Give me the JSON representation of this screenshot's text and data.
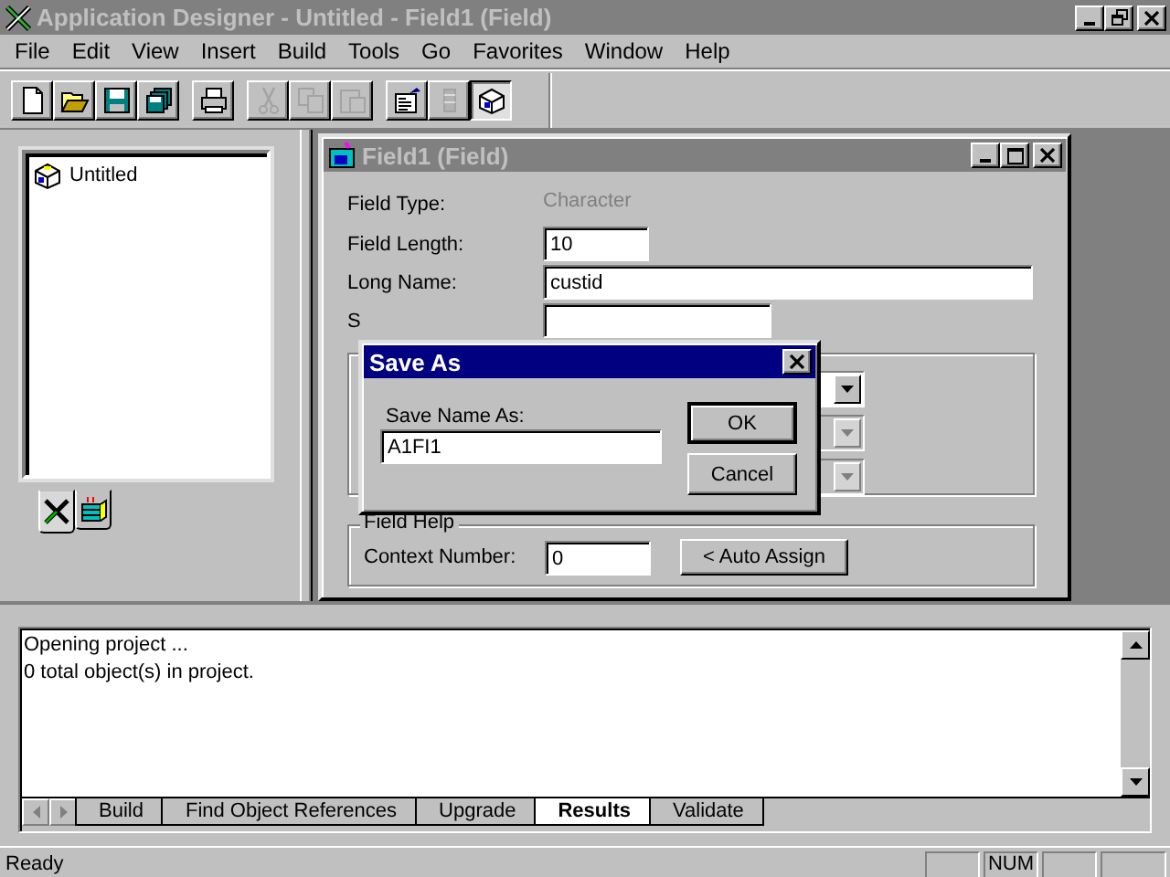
{
  "app": {
    "title": "Application Designer - Untitled - Field1 (Field)",
    "active": false
  },
  "menu": [
    {
      "label": "File"
    },
    {
      "label": "Edit"
    },
    {
      "label": "View"
    },
    {
      "label": "Insert"
    },
    {
      "label": "Build"
    },
    {
      "label": "Tools"
    },
    {
      "label": "Go"
    },
    {
      "label": "Favorites"
    },
    {
      "label": "Window"
    },
    {
      "label": "Help"
    }
  ],
  "toolbar": [
    {
      "kind": "new",
      "disabled": false,
      "pressed": false
    },
    {
      "kind": "open",
      "disabled": false,
      "pressed": false
    },
    {
      "kind": "save",
      "disabled": false,
      "pressed": false
    },
    {
      "kind": "save-all",
      "disabled": false,
      "pressed": false
    },
    {
      "kind": "sep"
    },
    {
      "kind": "print",
      "disabled": false,
      "pressed": false
    },
    {
      "kind": "sep"
    },
    {
      "kind": "cut",
      "disabled": true,
      "pressed": false
    },
    {
      "kind": "copy",
      "disabled": true,
      "pressed": false
    },
    {
      "kind": "paste",
      "disabled": true,
      "pressed": false
    },
    {
      "kind": "sep"
    },
    {
      "kind": "properties",
      "disabled": false,
      "pressed": false
    },
    {
      "kind": "script",
      "disabled": true,
      "pressed": false
    },
    {
      "kind": "workspace",
      "disabled": false,
      "pressed": true
    }
  ],
  "project": {
    "tree": [
      {
        "label": "Untitled",
        "selected": false
      }
    ],
    "tabs": [
      {
        "kind": "tools",
        "selected": true
      },
      {
        "kind": "objects",
        "selected": false
      }
    ]
  },
  "field_window": {
    "title": "Field1 (Field)",
    "active": false,
    "rows": [
      {
        "kind": "static",
        "label": "Field Type:",
        "value": "Character"
      },
      {
        "kind": "short",
        "label": "Field Length:",
        "value": "10"
      },
      {
        "kind": "long",
        "label": "Long Name:",
        "value": "custid"
      },
      {
        "kind": "medium",
        "label": "S"
      }
    ],
    "dropdowns": [
      {
        "disabled": false
      },
      {
        "disabled": true
      },
      {
        "disabled": true
      }
    ],
    "help": {
      "title": "Field Help",
      "label": "Context Number:",
      "value": "0",
      "button": "< Auto Assign"
    }
  },
  "dialog": {
    "title": "Save As",
    "label": "Save Name As:",
    "value": "A1FI1",
    "buttons": [
      {
        "label": "OK",
        "default": true
      },
      {
        "label": "Cancel",
        "default": false
      }
    ]
  },
  "output": {
    "lines": [
      "Opening project ...",
      "0  total object(s) in project."
    ],
    "tabs": [
      {
        "label": "Build",
        "selected": false
      },
      {
        "label": "Find Object References",
        "selected": false
      },
      {
        "label": "Upgrade",
        "selected": false
      },
      {
        "label": "Results",
        "selected": true
      },
      {
        "label": "Validate",
        "selected": false
      }
    ]
  },
  "status": {
    "text": "Ready",
    "panes": [
      {
        "kind": "blank"
      },
      {
        "kind": "text",
        "label": "NUM"
      },
      {
        "kind": "blank"
      },
      {
        "kind": "blank"
      }
    ]
  }
}
